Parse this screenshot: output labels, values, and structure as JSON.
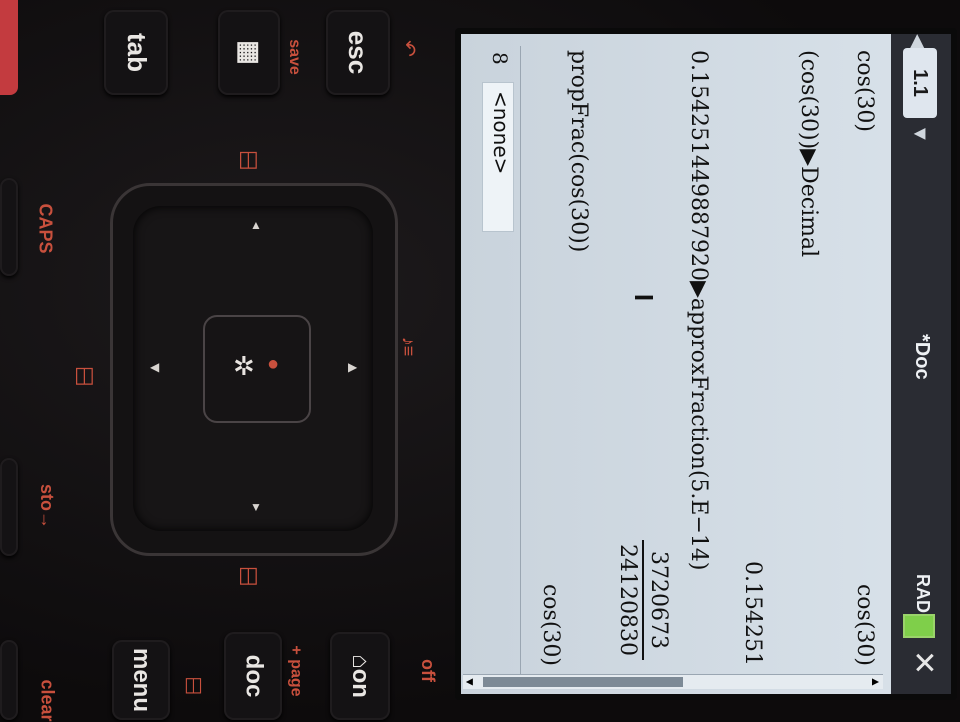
{
  "screen": {
    "tab_label": "1.1",
    "doc_title": "*Doc",
    "mode": "RAD",
    "history": [
      {
        "input": "cos(30)",
        "output": "cos(30)"
      },
      {
        "input": "(cos(30))▶Decimal",
        "output": "0.154251"
      },
      {
        "input": "0.154251449887920▶approxFraction(5.E−14)",
        "output_num": "3720673",
        "output_den": "24120830"
      },
      {
        "input": "propFrac(cos(30))",
        "output": "cos(30)"
      }
    ],
    "entry_prefix": "8",
    "entry_value": "<none>"
  },
  "keys": {
    "esc": "esc",
    "tab": "tab",
    "home": "⌂on",
    "doc": "doc",
    "menu": "menu"
  },
  "labels": {
    "save": "save",
    "caps": "CAPS",
    "sto": "sto→",
    "off": "off",
    "page": "+ page",
    "clear": "clear"
  },
  "colors": {
    "accent_label": "#c8503d",
    "screen_bg": "#d9e2ea",
    "titlebar": "#2a2c33"
  }
}
